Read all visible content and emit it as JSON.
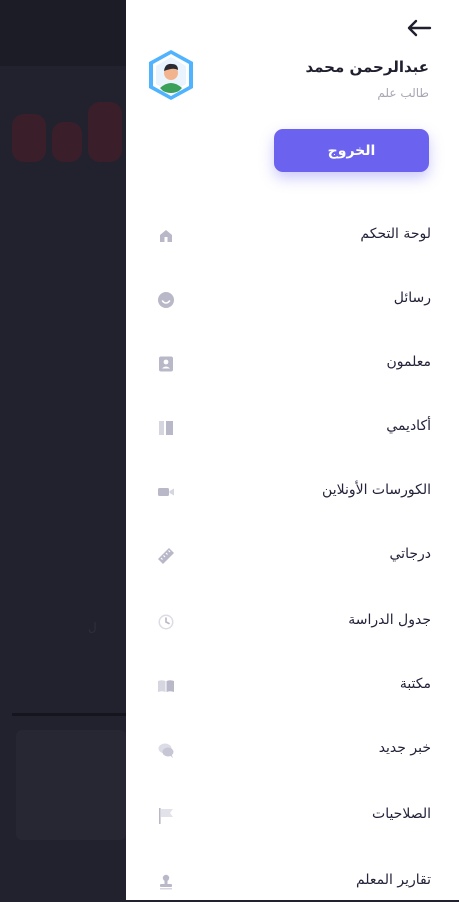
{
  "profile": {
    "name": "عبدالرحمن محمد",
    "role": "طالب علم"
  },
  "logout_label": "الخروج",
  "background_app": {
    "hint_text": "ل"
  },
  "menu": [
    {
      "label": "لوحة التحكم",
      "icon": "home-icon"
    },
    {
      "label": "رسائل",
      "icon": "smile-icon"
    },
    {
      "label": "معلمون",
      "icon": "contact-card-icon"
    },
    {
      "label": "أكاديمي",
      "icon": "columns-icon"
    },
    {
      "label": "الكورسات الأونلاين",
      "icon": "video-camera-icon"
    },
    {
      "label": "درجاتي",
      "icon": "ruler-icon"
    },
    {
      "label": "جدول الدراسة",
      "icon": "clock-icon"
    },
    {
      "label": "مكتبة",
      "icon": "book-icon"
    },
    {
      "label": "خبر جديد",
      "icon": "chat-bubbles-icon"
    },
    {
      "label": "الصلاحيات",
      "icon": "flag-icon"
    },
    {
      "label": "تقارير المعلم",
      "icon": "stamp-icon"
    }
  ],
  "colors": {
    "accent": "#6b63f0",
    "overlay": "#22222f",
    "icon_muted": "#b8b8c8",
    "avatar_ring": "#4fb3ff"
  }
}
